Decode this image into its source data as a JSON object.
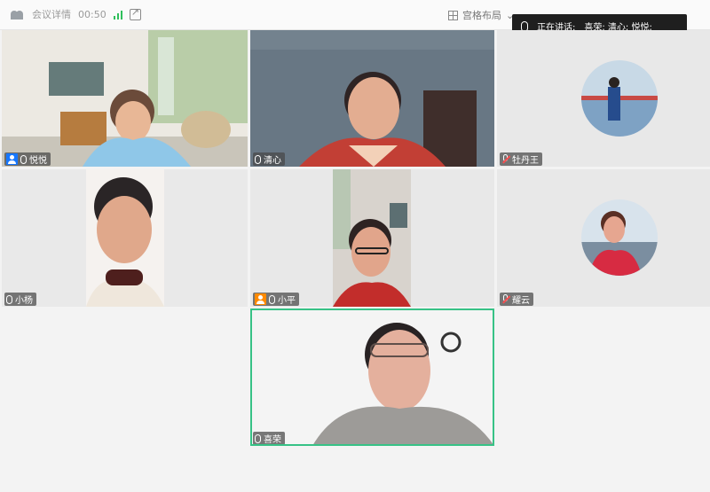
{
  "topbar": {
    "meeting_info_label": "会议详情",
    "timer": "00:50",
    "layout_label": "宫格布局",
    "speaking_label": "正在讲话:",
    "speaking_names": "喜荣; 清心; 悦悦;"
  },
  "participants": [
    {
      "name": "悦悦",
      "host": true
    },
    {
      "name": "清心"
    },
    {
      "name": "牡丹王",
      "muted": true
    },
    {
      "name": "小杨"
    },
    {
      "name": "小平",
      "host": true
    },
    {
      "name": "耀云",
      "muted": true
    },
    {
      "name": "喜荣",
      "active_speaker": true
    }
  ],
  "colors": {
    "accent": "#37c286",
    "host_blue": "#1677ff",
    "host_orange": "#ff8a00"
  }
}
